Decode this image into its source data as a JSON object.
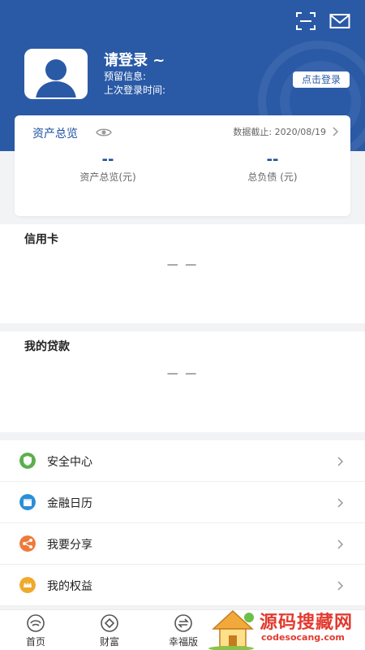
{
  "header": {
    "user_name": "请登录 ~",
    "reserved_info_label": "预留信息:",
    "last_login_label": "上次登录时间:",
    "login_button": "点击登录"
  },
  "assets": {
    "title": "资产总览",
    "date_label": "数据截止: 2020/08/19",
    "total_assets_value": "--",
    "total_assets_label": "资产总览(元)",
    "total_debt_value": "--",
    "total_debt_label": "总负债 (元)"
  },
  "credit_card": {
    "title": "信用卡",
    "placeholder": "— —"
  },
  "loan": {
    "title": "我的贷款",
    "placeholder": "— —"
  },
  "menu": [
    {
      "label": "安全中心",
      "icon": "shield-icon",
      "color": "#5ab04b"
    },
    {
      "label": "金融日历",
      "icon": "calendar-icon",
      "color": "#2a8fd6"
    },
    {
      "label": "我要分享",
      "icon": "share-icon",
      "color": "#ee7a3a"
    },
    {
      "label": "我的权益",
      "icon": "crown-icon",
      "color": "#f0a92a"
    }
  ],
  "tabs": [
    {
      "label": "首页",
      "icon": "home-icon"
    },
    {
      "label": "财富",
      "icon": "wealth-icon"
    },
    {
      "label": "幸福版",
      "icon": "switch-icon"
    }
  ],
  "watermark": {
    "text": "源码搜藏网",
    "url": "codesocang.com"
  },
  "colors": {
    "primary": "#2a5aa6",
    "title_blue": "#1b4fa0"
  }
}
